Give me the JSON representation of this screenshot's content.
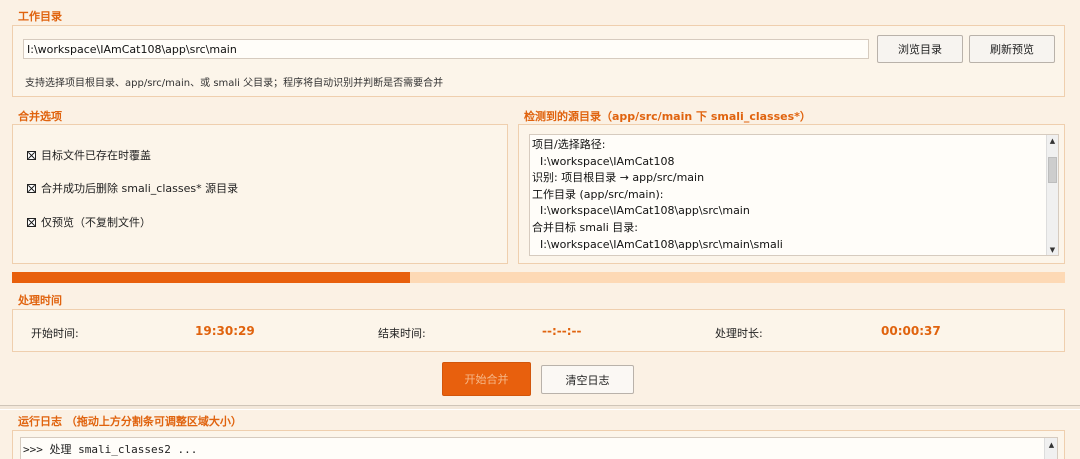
{
  "workdir": {
    "title": "工作目录",
    "path_value": "I:\\workspace\\IAmCat108\\app\\src\\main",
    "browse_label": "浏览目录",
    "refresh_label": "刷新预览",
    "hint": "支持选择项目根目录、app/src/main、或 smali 父目录；程序将自动识别并判断是否需要合并"
  },
  "options": {
    "title": "合并选项",
    "items": [
      {
        "label": "目标文件已存在时覆盖",
        "checked": true
      },
      {
        "label": "合并成功后删除 smali_classes* 源目录",
        "checked": true
      },
      {
        "label": "仅预览（不复制文件）",
        "checked": true
      }
    ]
  },
  "detected": {
    "title": "检测到的源目录（app/src/main 下 smali_classes*）",
    "lines": [
      {
        "text": "项目/选择路径:",
        "indent": false
      },
      {
        "text": "I:\\workspace\\IAmCat108",
        "indent": true
      },
      {
        "text": "识别: 项目根目录 → app/src/main",
        "indent": false
      },
      {
        "text": "工作目录 (app/src/main):",
        "indent": false
      },
      {
        "text": "I:\\workspace\\IAmCat108\\app\\src\\main",
        "indent": true
      },
      {
        "text": "合并目标 smali 目录:",
        "indent": false
      },
      {
        "text": "I:\\workspace\\IAmCat108\\app\\src\\main\\smali",
        "indent": true
      }
    ]
  },
  "progress": {
    "fraction": 0.378,
    "fill_color": "#e8600d",
    "track_color": "#fdd9b5"
  },
  "timing": {
    "title": "处理时间",
    "start_label": "开始时间:",
    "start_value": "19:30:29",
    "end_label": "结束时间:",
    "end_value": "--:--:--",
    "duration_label": "处理时长:",
    "duration_value": "00:00:37"
  },
  "actions": {
    "start_label": "开始合并",
    "clear_label": "清空日志"
  },
  "log": {
    "title": "运行日志 （拖动上方分割条可调整区域大小）",
    "first_line": ">>> 处理 smali_classes2 ..."
  },
  "colors": {
    "accent": "#e0630e",
    "background": "#fbf1e4"
  }
}
